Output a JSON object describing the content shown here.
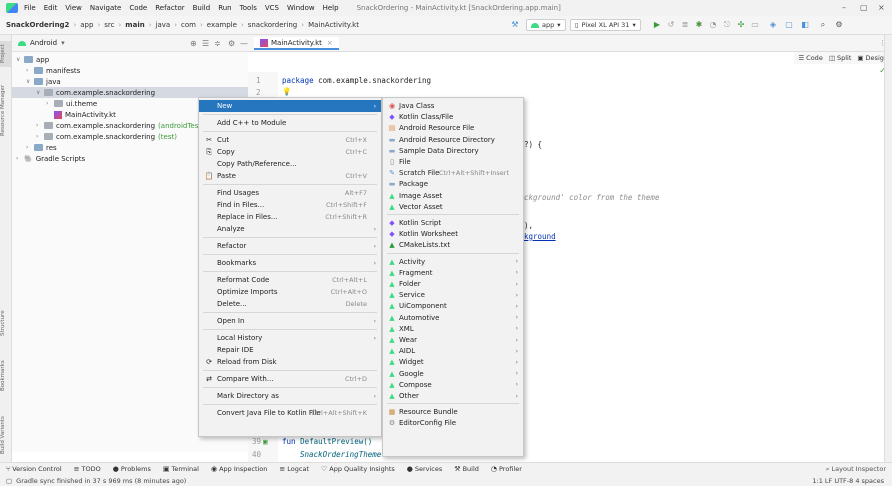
{
  "window": {
    "menus": [
      "File",
      "Edit",
      "View",
      "Navigate",
      "Code",
      "Refactor",
      "Build",
      "Run",
      "Tools",
      "VCS",
      "Window",
      "Help"
    ],
    "title": "SnackOrdering - MainActivity.kt [SnackOrdering.app.main]",
    "controls": [
      "–",
      "▢",
      "×"
    ]
  },
  "breadcrumbs": [
    "SnackOrdering2",
    "app",
    "src",
    "main",
    "java",
    "com",
    "example",
    "snackordering",
    "MainActivity.kt"
  ],
  "toolbar": {
    "run_config": "app",
    "device": "Pixel XL API 31"
  },
  "project_panel": {
    "view_selector": "Android",
    "tree": [
      {
        "label": "app",
        "indent": 0,
        "arrow": "v",
        "icon": "folder"
      },
      {
        "label": "manifests",
        "indent": 1,
        "arrow": ">",
        "icon": "folder"
      },
      {
        "label": "java",
        "indent": 1,
        "arrow": "v",
        "icon": "folder"
      },
      {
        "label": "com.example.snackordering",
        "indent": 2,
        "arrow": "v",
        "icon": "folder-gray",
        "selected": true
      },
      {
        "label": "ui.theme",
        "indent": 3,
        "arrow": ">",
        "icon": "folder-gray"
      },
      {
        "label": "MainActivity.kt",
        "indent": 3,
        "arrow": "",
        "icon": "kotlin"
      },
      {
        "label": "com.example.snackordering",
        "suffix": "(androidTest)",
        "indent": 2,
        "arrow": ">",
        "icon": "folder-gray"
      },
      {
        "label": "com.example.snackordering",
        "suffix": "(test)",
        "indent": 2,
        "arrow": ">",
        "icon": "folder-gray"
      },
      {
        "label": "res",
        "indent": 1,
        "arrow": ">",
        "icon": "folder"
      },
      {
        "label": "Gradle Scripts",
        "indent": 0,
        "arrow": ">",
        "icon": "gradle"
      }
    ]
  },
  "left_tool_tabs": [
    "Project",
    "Resource Manager",
    "Structure",
    "Bookmarks",
    "Build Variants"
  ],
  "editor": {
    "tab": "MainActivity.kt",
    "view_modes": [
      "Code",
      "Split",
      "Design"
    ],
    "line1_num": "1",
    "line1_kw": "package",
    "line1_pkg": "com.example.snackordering",
    "line2_num": "2",
    "fragment_paren": "?) {",
    "fragment_comment": "ckground' color from the theme",
    "fragment_close": "),",
    "fragment_link": "kground",
    "line39_num": "39",
    "line39_kw": "fun",
    "line39_text": "DefaultPreview()",
    "line40_num": "40",
    "line40_text": "SnackOrderingTheme"
  },
  "context_menu": [
    {
      "label": "New",
      "submenu": true,
      "highlight": true
    },
    {
      "sep": true
    },
    {
      "label": "Add C++ to Module"
    },
    {
      "sep": true
    },
    {
      "label": "Cut",
      "icon": "✂",
      "shortcut": "Ctrl+X"
    },
    {
      "label": "Copy",
      "icon": "⎘",
      "shortcut": "Ctrl+C"
    },
    {
      "label": "Copy Path/Reference..."
    },
    {
      "label": "Paste",
      "icon": "📋",
      "shortcut": "Ctrl+V"
    },
    {
      "sep": true
    },
    {
      "label": "Find Usages",
      "shortcut": "Alt+F7"
    },
    {
      "label": "Find in Files...",
      "shortcut": "Ctrl+Shift+F"
    },
    {
      "label": "Replace in Files...",
      "shortcut": "Ctrl+Shift+R"
    },
    {
      "label": "Analyze",
      "submenu": true
    },
    {
      "sep": true
    },
    {
      "label": "Refactor",
      "submenu": true
    },
    {
      "sep": true
    },
    {
      "label": "Bookmarks",
      "submenu": true
    },
    {
      "sep": true
    },
    {
      "label": "Reformat Code",
      "shortcut": "Ctrl+Alt+L"
    },
    {
      "label": "Optimize Imports",
      "shortcut": "Ctrl+Alt+O"
    },
    {
      "label": "Delete...",
      "shortcut": "Delete"
    },
    {
      "sep": true
    },
    {
      "label": "Open In",
      "submenu": true
    },
    {
      "sep": true
    },
    {
      "label": "Local History",
      "submenu": true
    },
    {
      "label": "Repair IDE"
    },
    {
      "label": "Reload from Disk",
      "icon": "⟳"
    },
    {
      "sep": true
    },
    {
      "label": "Compare With...",
      "icon": "⇄",
      "shortcut": "Ctrl+D"
    },
    {
      "sep": true
    },
    {
      "label": "Mark Directory as",
      "submenu": true
    },
    {
      "sep": true
    },
    {
      "label": "Convert Java File to Kotlin File",
      "shortcut": "Ctrl+Alt+Shift+K"
    }
  ],
  "new_submenu": [
    {
      "label": "Java Class",
      "icon": "java"
    },
    {
      "label": "Kotlin Class/File",
      "icon": "kotlin"
    },
    {
      "label": "Android Resource File",
      "icon": "res"
    },
    {
      "label": "Android Resource Directory",
      "icon": "folder"
    },
    {
      "label": "Sample Data Directory",
      "icon": "folder"
    },
    {
      "label": "File",
      "icon": "file"
    },
    {
      "label": "Scratch File",
      "icon": "scratch",
      "shortcut": "Ctrl+Alt+Shift+Insert"
    },
    {
      "label": "Package",
      "icon": "folder"
    },
    {
      "label": "Image Asset",
      "icon": "android"
    },
    {
      "label": "Vector Asset",
      "icon": "android"
    },
    {
      "sep": true
    },
    {
      "label": "Kotlin Script",
      "icon": "kotlin"
    },
    {
      "label": "Kotlin Worksheet",
      "icon": "kotlin"
    },
    {
      "label": "CMakeLists.txt",
      "icon": "cmake"
    },
    {
      "sep": true
    },
    {
      "label": "Activity",
      "icon": "android",
      "submenu": true
    },
    {
      "label": "Fragment",
      "icon": "android",
      "submenu": true
    },
    {
      "label": "Folder",
      "icon": "android",
      "submenu": true
    },
    {
      "label": "Service",
      "icon": "android",
      "submenu": true
    },
    {
      "label": "UiComponent",
      "icon": "android",
      "submenu": true
    },
    {
      "label": "Automotive",
      "icon": "android",
      "submenu": true
    },
    {
      "label": "XML",
      "icon": "android",
      "submenu": true
    },
    {
      "label": "Wear",
      "icon": "android",
      "submenu": true
    },
    {
      "label": "AIDL",
      "icon": "android",
      "submenu": true
    },
    {
      "label": "Widget",
      "icon": "android",
      "submenu": true
    },
    {
      "label": "Google",
      "icon": "android",
      "submenu": true
    },
    {
      "label": "Compose",
      "icon": "android",
      "submenu": true
    },
    {
      "label": "Other",
      "icon": "android",
      "submenu": true
    },
    {
      "sep": true
    },
    {
      "label": "Resource Bundle",
      "icon": "bundle"
    },
    {
      "label": "EditorConfig File",
      "icon": "gear"
    }
  ],
  "bottom_tools": [
    {
      "label": "Version Control",
      "icon": "⑂"
    },
    {
      "label": "TODO",
      "icon": "≡"
    },
    {
      "label": "Problems",
      "icon": "●"
    },
    {
      "label": "Terminal",
      "icon": "▣"
    },
    {
      "label": "App Inspection",
      "icon": "◉"
    },
    {
      "label": "Logcat",
      "icon": "≡"
    },
    {
      "label": "App Quality Insights",
      "icon": "♡"
    },
    {
      "label": "Services",
      "icon": "●"
    },
    {
      "label": "Build",
      "icon": "⚒"
    },
    {
      "label": "Profiler",
      "icon": "◔"
    }
  ],
  "layout_inspector": "Layout Inspector",
  "status": {
    "message": "Gradle sync finished in 37 s 969 ms (8 minutes ago)",
    "right": "1:1  LF  UTF-8  4 spaces"
  },
  "colors": {
    "accent": "#2675bf",
    "android": "#3ddc84"
  }
}
